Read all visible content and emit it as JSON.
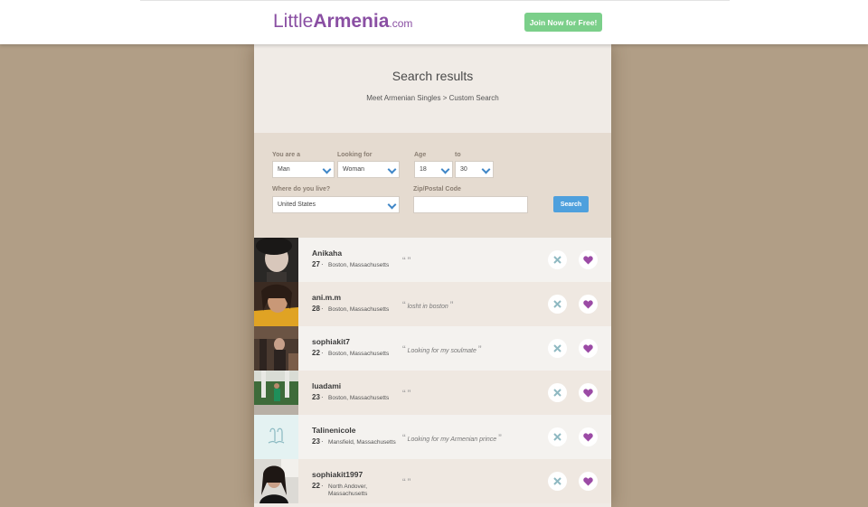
{
  "header": {
    "logo": {
      "part1": "Little",
      "part2": "Armenia",
      "part3": ".com"
    },
    "join_label": "Join Now for Free!"
  },
  "page": {
    "title": "Search results",
    "breadcrumb": "Meet Armenian Singles > Custom Search"
  },
  "search_form": {
    "you_are_label": "You are a",
    "you_are_value": "Man",
    "looking_for_label": "Looking for",
    "looking_for_value": "Woman",
    "age_label": "Age",
    "age_from": "18",
    "to_label": "to",
    "age_to": "30",
    "where_label": "Where do you live?",
    "country_value": "United States",
    "zip_label": "Zip/Postal Code",
    "zip_value": "",
    "search_label": "Search"
  },
  "results": [
    {
      "name": "Anikaha",
      "age": "27",
      "location": "Boston, Massachusetts",
      "quote": ""
    },
    {
      "name": "ani.m.m",
      "age": "28",
      "location": "Boston, Massachusetts",
      "quote": "losht in boston"
    },
    {
      "name": "sophiakit7",
      "age": "22",
      "location": "Boston, Massachusetts",
      "quote": "Looking for my soulmate"
    },
    {
      "name": "luadami",
      "age": "23",
      "location": "Boston, Massachusetts",
      "quote": ""
    },
    {
      "name": "Talinenicole",
      "age": "23",
      "location": "Mansfield, Massachusetts",
      "quote": "Looking for my Armenian prince"
    },
    {
      "name": "sophiakit1997",
      "age": "22",
      "location": "North Andover, Massachusetts",
      "quote": ""
    }
  ],
  "colors": {
    "background": "#b19e86",
    "brand_purple": "#8a4fa3",
    "join_green": "#7bcf8a",
    "search_blue": "#4ea0dd",
    "dismiss_teal": "#8fb9c2",
    "heart_purple": "#9b4aa5"
  },
  "icons": {
    "dismiss": "close-icon",
    "like": "heart-icon",
    "select": "chevron-down-icon",
    "placeholder_avatar": "zodiac-placeholder-icon"
  }
}
